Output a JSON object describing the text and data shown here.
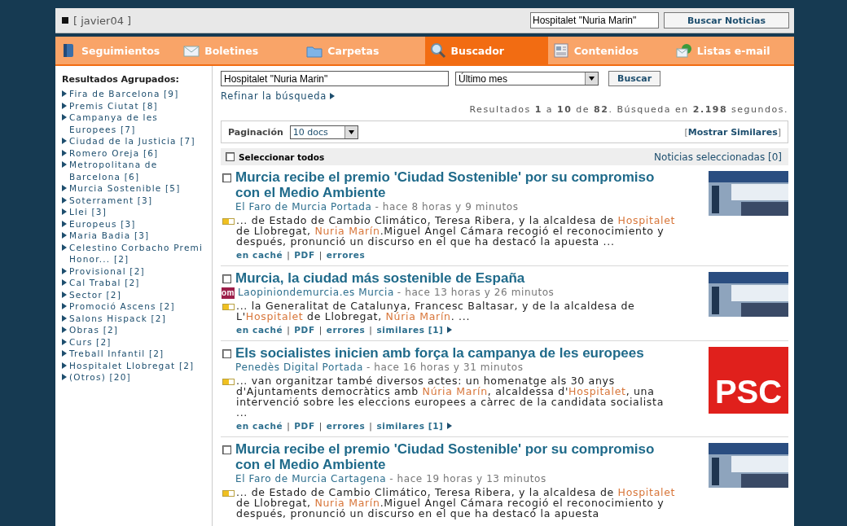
{
  "top_bar": {
    "user": "[ javier04 ]",
    "search": {
      "value": "Hospitalet \"Nuria Marin\""
    },
    "button": "Buscar Noticias"
  },
  "tabs": [
    {
      "label": "Seguimientos",
      "selected": false
    },
    {
      "label": "Boletines",
      "selected": false
    },
    {
      "label": "Carpetas",
      "selected": false
    },
    {
      "label": "Buscador",
      "selected": true
    },
    {
      "label": "Contenidos",
      "selected": false
    },
    {
      "label": "Listas e-mail",
      "selected": false
    }
  ],
  "sidebar": {
    "title": "Resultados Agrupados:",
    "items": [
      {
        "label": "Fira de Barcelona [9]"
      },
      {
        "label": "Premis Ciutat [8]"
      },
      {
        "label": "Campanya de les Europees [7]"
      },
      {
        "label": "Ciudad de la Justicia [7]"
      },
      {
        "label": "Romero Oreja [6]"
      },
      {
        "label": "Metropolitana de Barcelona [6]"
      },
      {
        "label": "Murcia Sostenible [5]"
      },
      {
        "label": "Soterrament [3]"
      },
      {
        "label": "Llei [3]"
      },
      {
        "label": "Europeus [3]"
      },
      {
        "label": "Maria Badia [3]"
      },
      {
        "label": "Celestino Corbacho Premi Honor... [2]"
      },
      {
        "label": "Provisional [2]"
      },
      {
        "label": "Cal Trabal [2]"
      },
      {
        "label": "Sector [2]"
      },
      {
        "label": "Promoció Ascens [2]"
      },
      {
        "label": "Salons Hispack [2]"
      },
      {
        "label": "Obras [2]"
      },
      {
        "label": "Curs [2]"
      },
      {
        "label": "Treball Infantil [2]"
      },
      {
        "label": "Hospitalet Llobregat [2]"
      },
      {
        "label": "(Otros) [20]"
      }
    ]
  },
  "search": {
    "query": "Hospitalet \"Nuria Marin\"",
    "period": "Último mes",
    "button": "Buscar",
    "refine": "Refinar la búsqueda",
    "summary": "Resultados **1** a **10** de **82**. Búsqueda en **2.198** segundos."
  },
  "pagination": {
    "label": "Paginación",
    "value": "10 docs",
    "similar": "[**Mostrar Similares**]"
  },
  "selection": {
    "select_all": "Seleccionar todos",
    "checked": false,
    "selected_count": "Noticias seleccionadas [0]"
  },
  "link_separator": "|",
  "results": [
    {
      "checked": false,
      "title": "Murcia recibe el premio 'Ciudad Sostenible' por su compromiso con el Medio Ambiente",
      "source": "El Faro de Murcia Portada",
      "time": "- hace 8 horas y 9 minutos",
      "snippet": [
        {
          "text": "... de Estado de Cambio Climático, Teresa Ribera, y la alcaldesa de ",
          "highlight": false
        },
        {
          "text": "Hospitalet",
          "highlight": true
        },
        {
          "text": " de Llobregat, ",
          "highlight": false
        },
        {
          "text": "Nuria Marín",
          "highlight": true
        },
        {
          "text": ".Miguel Ángel Cámara recogió el reconocimiento y después, pronunció un discurso en el que ha destacó la apuesta ...",
          "highlight": false
        }
      ],
      "links": [
        {
          "label": "en caché",
          "arrow": false
        },
        {
          "label": "PDF",
          "arrow": false
        },
        {
          "label": "errores",
          "arrow": false
        }
      ],
      "thumbnail": {
        "kind": "photo"
      }
    },
    {
      "checked": false,
      "title": "Murcia, la ciudad más sostenible de España",
      "favicon": "om",
      "source": "Laopiniondemurcia.es Murcia",
      "time": "- hace 13 horas y 26 minutos",
      "snippet": [
        {
          "text": "... la Generalitat de Catalunya, Francesc Baltasar, y de la alcaldesa de L'",
          "highlight": false
        },
        {
          "text": "Hospitalet",
          "highlight": true
        },
        {
          "text": " de Llobregat, ",
          "highlight": false
        },
        {
          "text": "Núria Marín",
          "highlight": true
        },
        {
          "text": ". ...",
          "highlight": false
        }
      ],
      "links": [
        {
          "label": "en caché",
          "arrow": false
        },
        {
          "label": "PDF",
          "arrow": false
        },
        {
          "label": "errores",
          "arrow": false
        },
        {
          "label": "similares [1]",
          "arrow": true
        }
      ],
      "thumbnail": {
        "kind": "photo"
      }
    },
    {
      "checked": false,
      "title": "Els socialistes inicien amb força la campanya de les europees",
      "source": "Penedès Digital Portada",
      "time": "- hace 16 horas y 31 minutos",
      "snippet": [
        {
          "text": "... van organitzar també diversos actes: un homenatge als 30 anys d'Ajuntaments democràtics amb ",
          "highlight": false
        },
        {
          "text": "Núria Marín",
          "highlight": true
        },
        {
          "text": ", alcaldessa d'",
          "highlight": false
        },
        {
          "text": "Hospitalet",
          "highlight": true
        },
        {
          "text": ", una intervenció sobre les eleccions europees a càrrec de la candidata socialista ...",
          "highlight": false
        }
      ],
      "links": [
        {
          "label": "en caché",
          "arrow": false
        },
        {
          "label": "PDF",
          "arrow": false
        },
        {
          "label": "errores",
          "arrow": false
        },
        {
          "label": "similares [1]",
          "arrow": true
        }
      ],
      "thumbnail": {
        "kind": "logo",
        "text": "PSC"
      }
    },
    {
      "checked": false,
      "title": "Murcia recibe el premio 'Ciudad Sostenible' por su compromiso con el Medio Ambiente",
      "source": "El Faro de Murcia Cartagena",
      "time": "- hace 19 horas y 13 minutos",
      "snippet": [
        {
          "text": "... de Estado de Cambio Climático, Teresa Ribera, y la alcaldesa de ",
          "highlight": false
        },
        {
          "text": "Hospitalet",
          "highlight": true
        },
        {
          "text": " de Llobregat, ",
          "highlight": false
        },
        {
          "text": "Nuria Marín",
          "highlight": true
        },
        {
          "text": ".Miguel Ángel Cámara recogió el reconocimiento y después, pronunció un discurso en el que ha destacó la apuesta",
          "highlight": false
        }
      ],
      "thumbnail": {
        "kind": "photo"
      }
    }
  ]
}
